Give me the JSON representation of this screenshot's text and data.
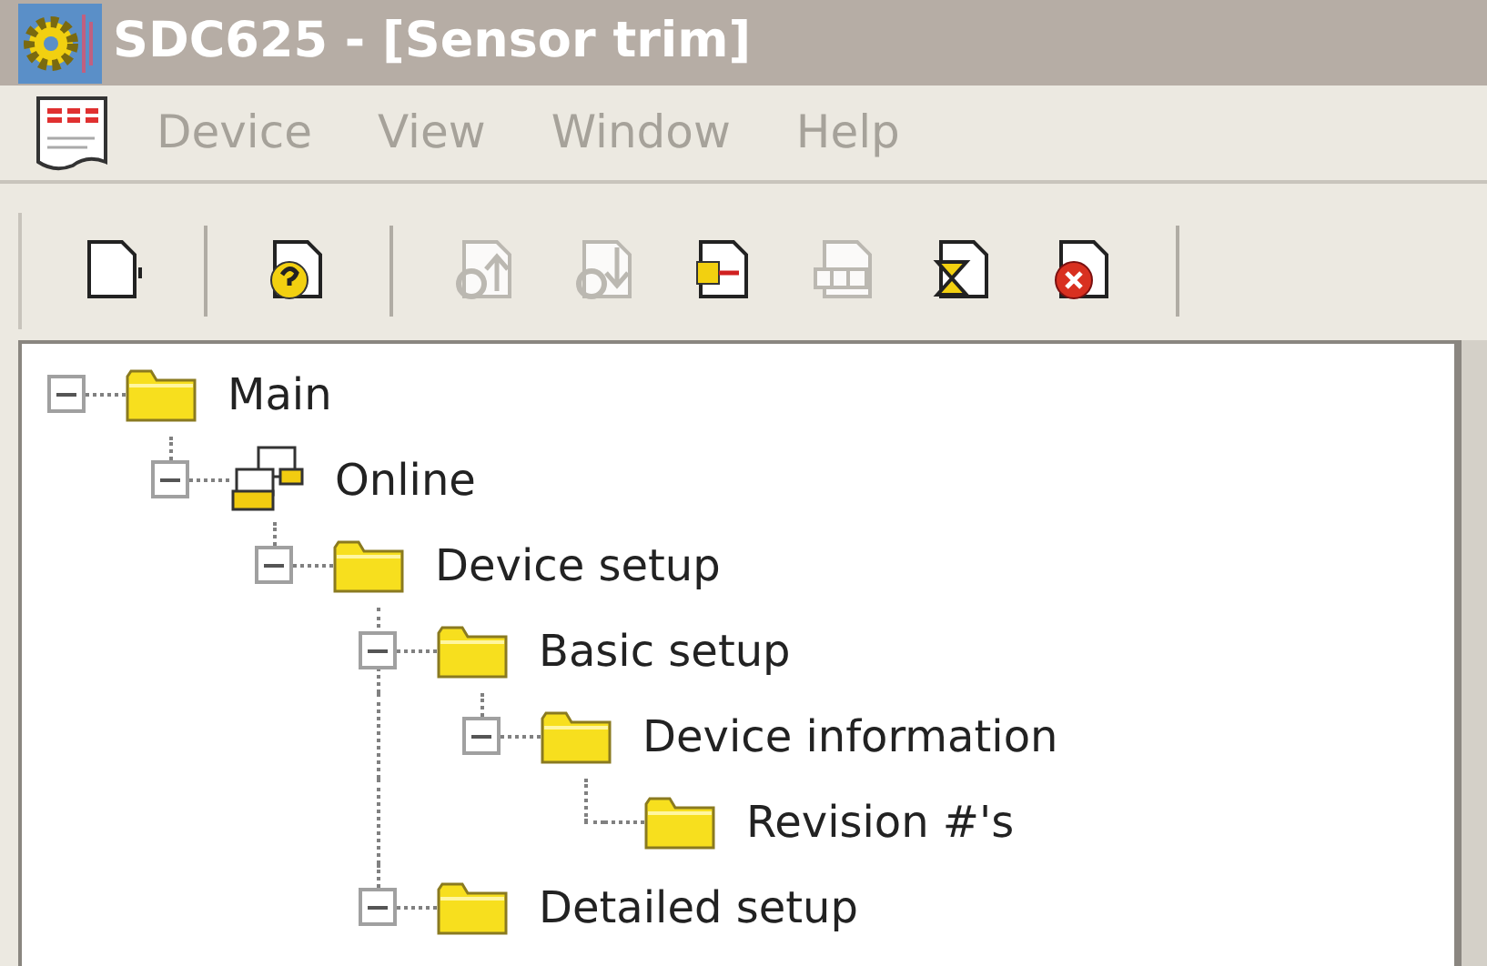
{
  "window": {
    "title": "SDC625 - [Sensor trim]"
  },
  "menu": [
    {
      "label": "Device",
      "disabled": true
    },
    {
      "label": "View",
      "disabled": true
    },
    {
      "label": "Window",
      "disabled": true
    },
    {
      "label": "Help",
      "disabled": true
    }
  ],
  "toolbar": [
    {
      "kind": "new",
      "disabled": false
    },
    {
      "kind": "separator"
    },
    {
      "kind": "help",
      "disabled": false
    },
    {
      "kind": "separator"
    },
    {
      "kind": "upload",
      "disabled": true
    },
    {
      "kind": "download",
      "disabled": true
    },
    {
      "kind": "import",
      "disabled": false
    },
    {
      "kind": "windows",
      "disabled": true
    },
    {
      "kind": "wait",
      "disabled": false
    },
    {
      "kind": "stop",
      "disabled": false
    },
    {
      "kind": "separator"
    }
  ],
  "tree": [
    {
      "label": "Main",
      "kind": "folder",
      "expanded": true,
      "children": [
        {
          "label": "Online",
          "kind": "online",
          "expanded": true,
          "children": [
            {
              "label": "Device setup",
              "kind": "folder",
              "expanded": true,
              "children": [
                {
                  "label": "Basic setup",
                  "kind": "folder",
                  "expanded": true,
                  "children": [
                    {
                      "label": "Device information",
                      "kind": "folder",
                      "expanded": true,
                      "children": [
                        {
                          "label": "Revision #'s",
                          "kind": "folder"
                        }
                      ]
                    }
                  ]
                },
                {
                  "label": "Detailed setup",
                  "kind": "folder",
                  "expanded": true
                }
              ]
            }
          ]
        }
      ]
    }
  ]
}
